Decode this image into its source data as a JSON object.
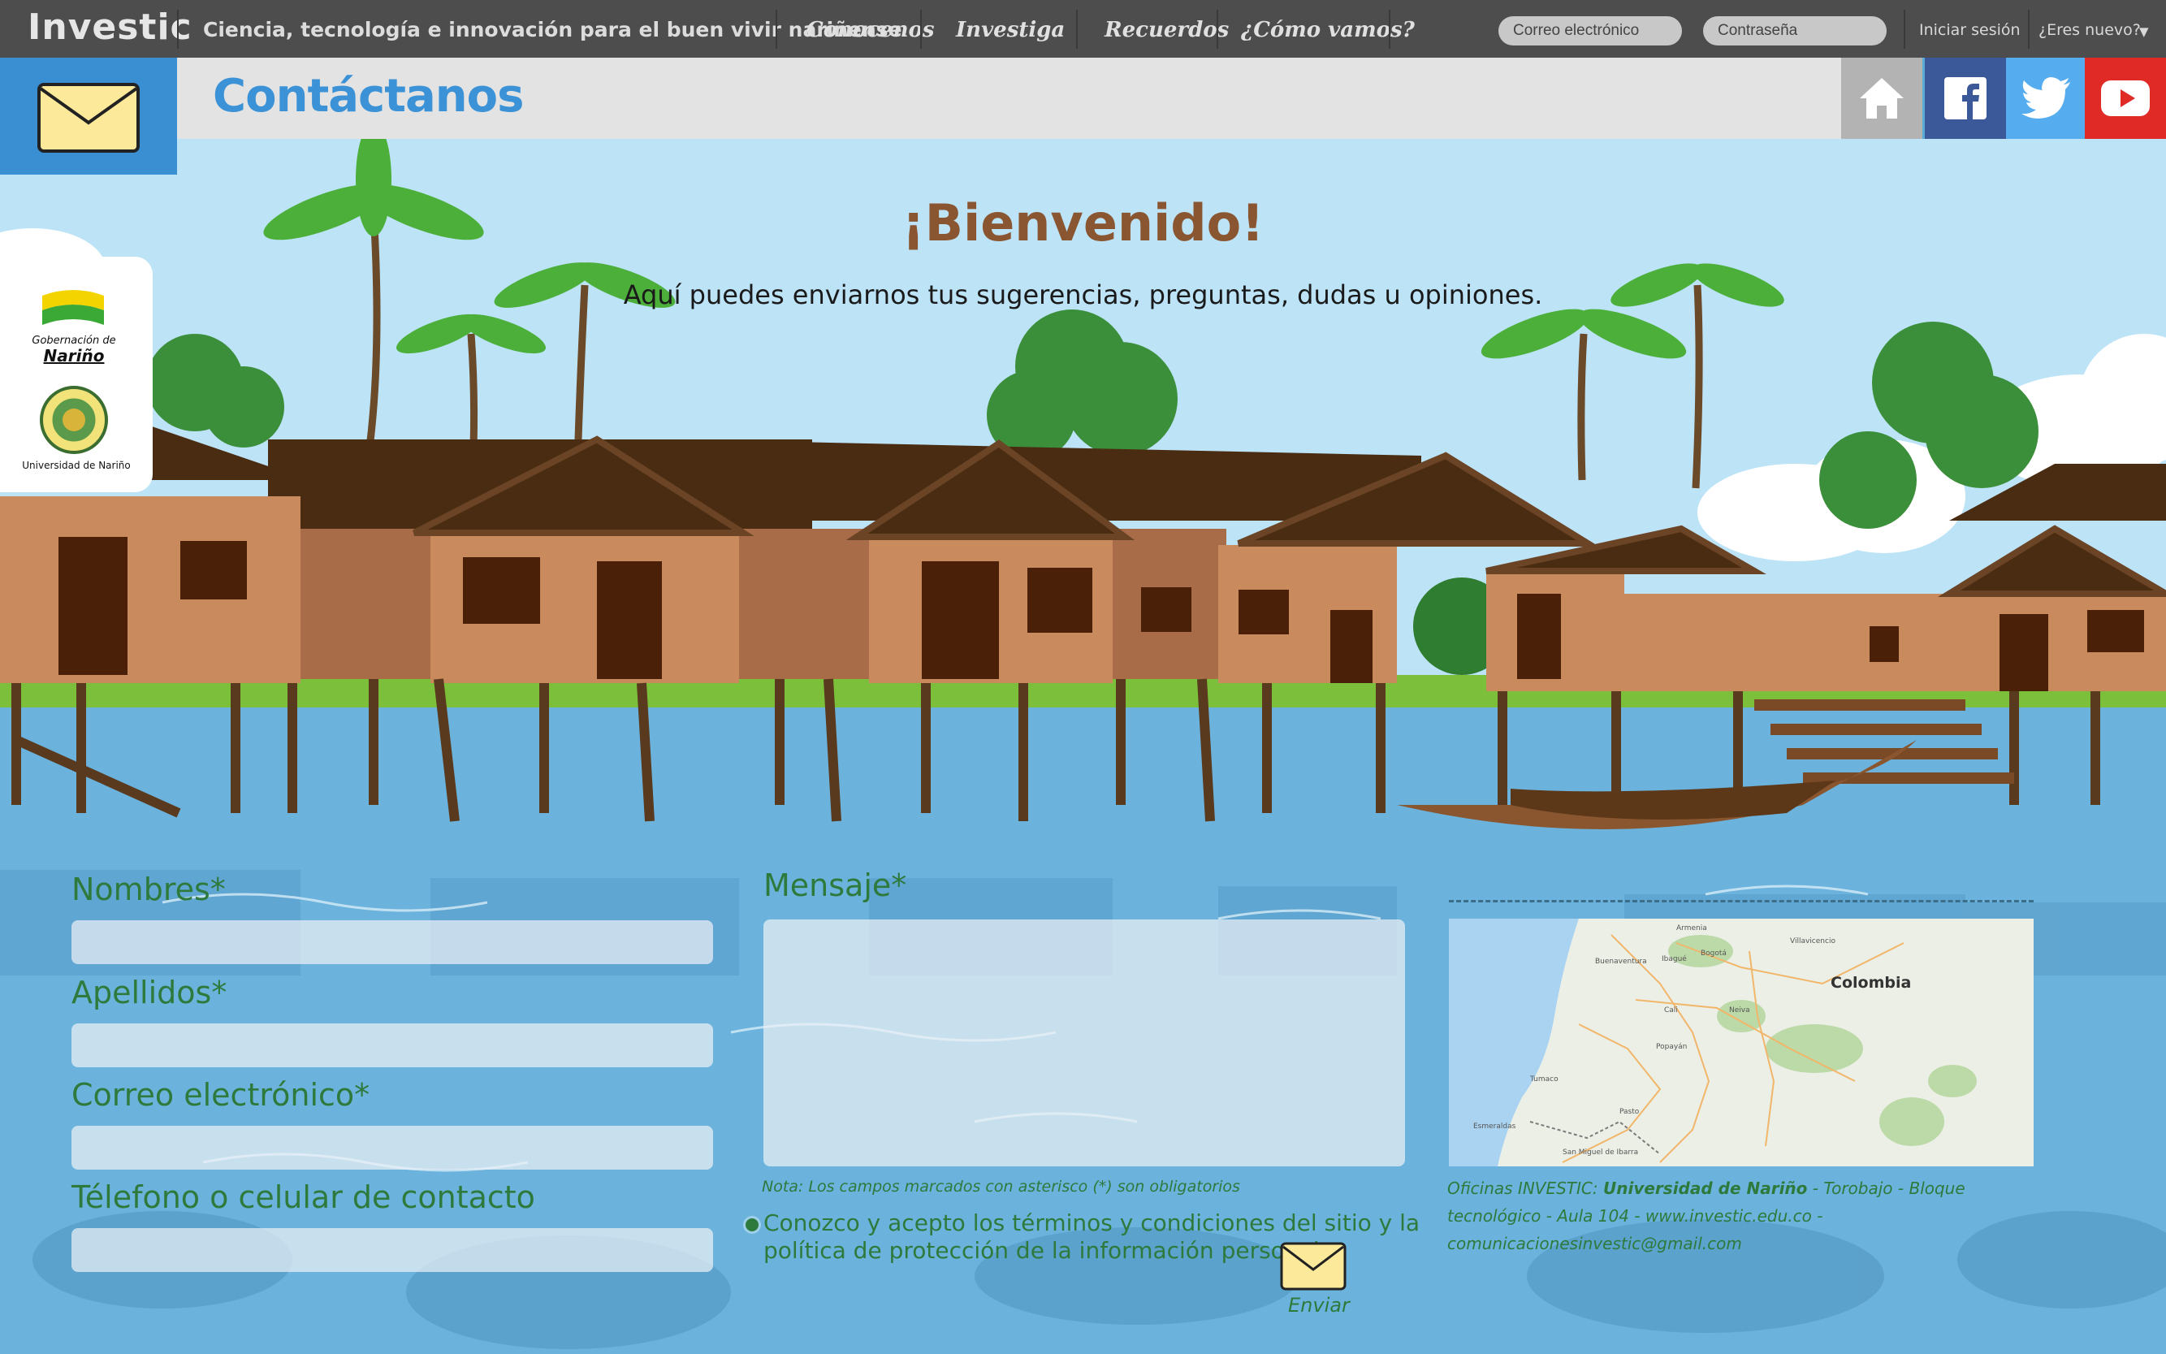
{
  "header": {
    "brand": "Investic",
    "tagline": "Ciencia, tecnología e innovación para el  buen vivir nariñense",
    "nav": [
      "Conocenos",
      "Investiga",
      "Recuerdos",
      "¿Cómo vamos?"
    ],
    "email_placeholder": "Correo electrónico",
    "password_placeholder": "Contraseña",
    "login_label": "Iniciar sesión",
    "signup_label": "¿Eres nuevo?",
    "signup_arrow": "▼"
  },
  "page": {
    "title": "Contáctanos",
    "mail_icon": "envelope-icon"
  },
  "social": {
    "home": {
      "icon": "home-icon",
      "color": "#b3b3b3"
    },
    "facebook": {
      "icon": "facebook-icon",
      "color": "#3b5998"
    },
    "twitter": {
      "icon": "twitter-icon",
      "color": "#55acee"
    },
    "youtube": {
      "icon": "youtube-icon",
      "color": "#e02a26"
    }
  },
  "welcome": {
    "title": "¡Bienvenido!",
    "subtitle": "Aquí puedes enviarnos tus sugerencias, preguntas, dudas u opiniones."
  },
  "logos": {
    "gobernacion_line1": "Gobernación de",
    "gobernacion_line2": "Nariño",
    "universidad": "Universidad de Nariño"
  },
  "form": {
    "first_name_label": "Nombres*",
    "last_name_label": "Apellidos*",
    "email_label": "Correo electrónico*",
    "phone_label": "Télefono o celular de contacto",
    "message_label": "Mensaje*",
    "note": "Nota: Los campos marcados con asterisco (*) son obligatorios",
    "terms_line1": "Conozco y acepto los términos y condiciones del sitio y la",
    "terms_line2": "política de protección de la información personal",
    "send_label": "Enviar"
  },
  "map": {
    "country_label": "Colombia",
    "cities": [
      "Armenia",
      "Ibagué",
      "Bogotá",
      "Villavicencio",
      "Cali",
      "Neiva",
      "Popayán",
      "Pasto",
      "Tumaco",
      "Buenaventura",
      "Esmeraldas",
      "San Miguel de Ibarra"
    ]
  },
  "address": {
    "prefix": "Oficinas INVESTIC: ",
    "university": "Universidad de Nariño",
    "rest": " - Torobajo - Bloque tecnológico - Aula 104 - www.investic.edu.co - comunicacionesinvestic@gmail.com"
  },
  "colors": {
    "accent_blue": "#3b92d6",
    "title_brown": "#8a5632",
    "form_green": "#2e7a3c",
    "topbar": "#4d4d4d"
  }
}
